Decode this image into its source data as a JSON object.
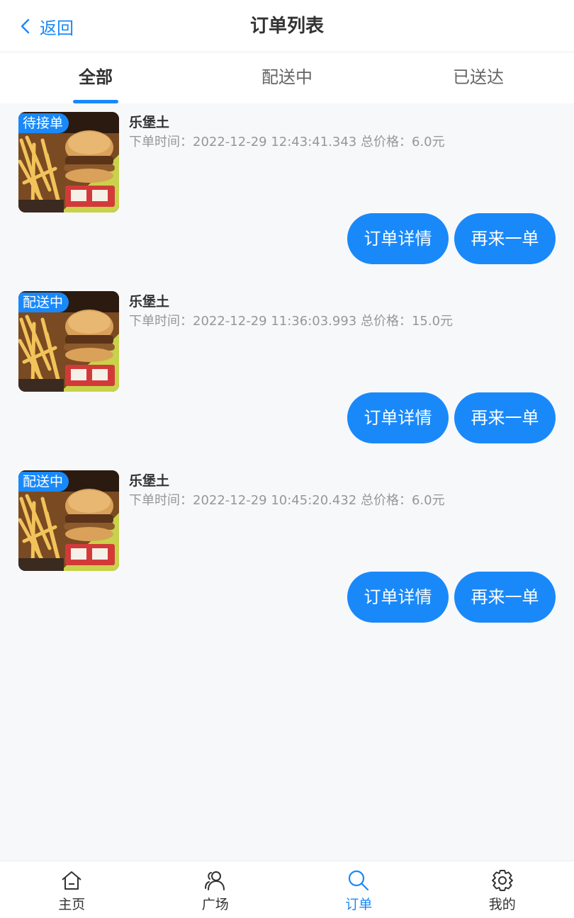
{
  "navbar": {
    "back_label": "返回",
    "title": "订单列表"
  },
  "tabs": [
    {
      "label": "全部"
    },
    {
      "label": "配送中"
    },
    {
      "label": "已送达"
    }
  ],
  "orders": [
    {
      "status": "待接单",
      "name": "乐堡土",
      "desc": "下单时间：2022-12-29 12:43:41.343 总价格：6.0元",
      "detail_btn": "订单详情",
      "again_btn": "再来一单"
    },
    {
      "status": "配送中",
      "name": "乐堡土",
      "desc": "下单时间：2022-12-29 11:36:03.993 总价格：15.0元",
      "detail_btn": "订单详情",
      "again_btn": "再来一单"
    },
    {
      "status": "配送中",
      "name": "乐堡土",
      "desc": "下单时间：2022-12-29 10:45:20.432 总价格：6.0元",
      "detail_btn": "订单详情",
      "again_btn": "再来一单"
    }
  ],
  "tabbar": [
    {
      "label": "主页",
      "icon": "home-icon"
    },
    {
      "label": "广场",
      "icon": "friends-icon"
    },
    {
      "label": "订单",
      "icon": "search-icon"
    },
    {
      "label": "我的",
      "icon": "setting-icon"
    }
  ],
  "colors": {
    "primary": "#1989fa",
    "background": "#f7f8fa",
    "text": "#323233",
    "muted": "#969799"
  }
}
